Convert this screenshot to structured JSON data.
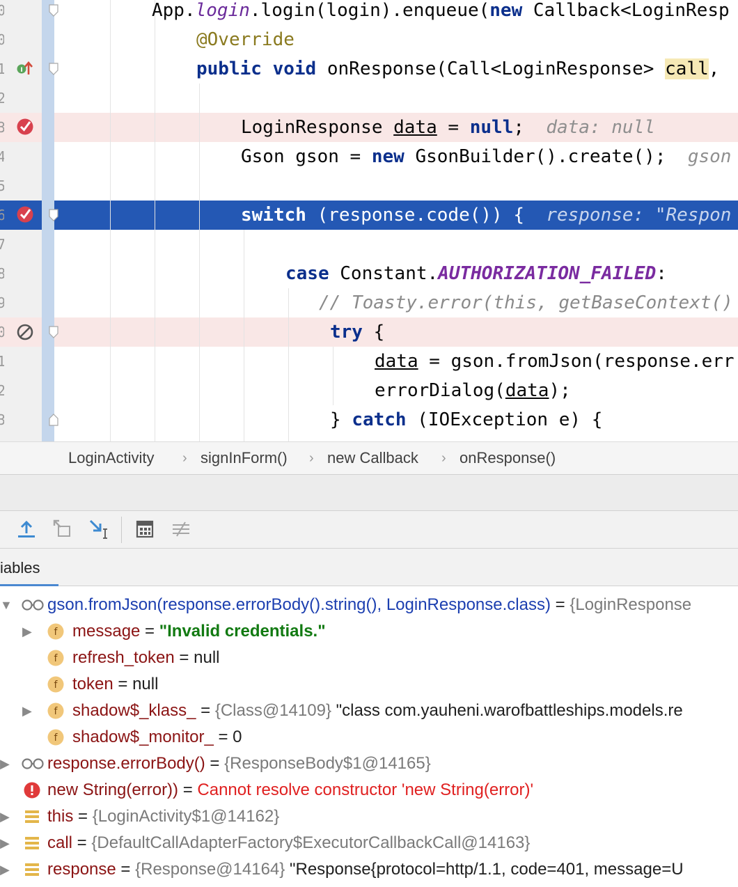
{
  "editor": {
    "lines": {
      "l1": {
        "a": "App.",
        "b": "login",
        "c": ".login(login).enqueue(",
        "d": "new",
        "e": " Callback<LoginResp"
      },
      "l2": {
        "a": "@Override"
      },
      "l3": {
        "a": "public",
        "b": " ",
        "c": "void",
        "d": " onResponse(Call<LoginResponse> ",
        "e": "call",
        ",f": ","
      },
      "l5": {
        "a": "LoginResponse ",
        "b": "data",
        "c": " = ",
        "d": "null",
        "e": ";",
        "hint": "data: null"
      },
      "l6": {
        "a": "Gson gson = ",
        "b": "new",
        "c": " GsonBuilder().create();",
        "hint": "gson"
      },
      "l8": {
        "a": "switch",
        "b": " (response.code()) {",
        "hint": "response: \"Respon"
      },
      "l10": {
        "a": "case",
        "b": " Constant.",
        "c": "AUTHORIZATION_FAILED",
        "d": ":"
      },
      "l11": {
        "a": "// Toasty.error(this, getBaseContext()"
      },
      "l12": {
        "a": "try",
        "b": " {"
      },
      "l13": {
        "a": "data",
        "b": " = gson.fromJson(response.err"
      },
      "l14": {
        "a": "errorDialog(",
        "b": "data",
        "c": ");"
      },
      "l15": {
        "a": "} ",
        "b": "catch",
        "c": " (IOException e) {"
      }
    }
  },
  "breadcrumb": [
    "LoginActivity",
    "signInForm()",
    "new Callback",
    "onResponse()"
  ],
  "breadcrumb_sep": "›",
  "variables_tab": "iables",
  "variables": [
    {
      "arrow": "▼",
      "name": "gson.fromJson(response.errorBody().string(), LoginResponse.class)",
      "eq": " = ",
      "ref": "{LoginResponse"
    },
    {
      "arrow": "▶",
      "name": "message",
      "eq": " = ",
      "str": "\"Invalid credentials.\""
    },
    {
      "name": "refresh_token",
      "eq": " = ",
      "val": "null"
    },
    {
      "name": "token",
      "eq": " = ",
      "val": "null"
    },
    {
      "arrow": "▶",
      "name": "shadow$_klass_",
      "eq": " = ",
      "ref": "{Class@14109}",
      "val": " \"class com.yauheni.warofbattleships.models.re"
    },
    {
      "name": "shadow$_monitor_",
      "eq": " = ",
      "val": "0"
    },
    {
      "arrow": "▶",
      "name": "response.errorBody()",
      "eq": " = ",
      "ref": "{ResponseBody$1@14165}"
    },
    {
      "name": "new String(error))",
      "eq": " = ",
      "err": "Cannot resolve constructor 'new String(error)'"
    },
    {
      "arrow": "▶",
      "name": "this",
      "eq": " = ",
      "ref": "{LoginActivity$1@14162}"
    },
    {
      "arrow": "▶",
      "name": "call",
      "eq": " = ",
      "ref": "{DefaultCallAdapterFactory$ExecutorCallbackCall@14163}"
    },
    {
      "arrow": "▶",
      "name": "response",
      "eq": " = ",
      "ref": "{Response@14164}",
      "val": " \"Response{protocol=http/1.1, code=401, message=U"
    }
  ],
  "icon_names": {
    "field": "field-icon",
    "watch": "watch-glasses-icon",
    "error": "error-icon",
    "local": "local-variable-icon",
    "breakpoint": "breakpoint-check-icon",
    "disabled": "disabled-breakpoint-icon",
    "override": "override-implements-icon",
    "step_out": "step-out-icon",
    "drop_frame": "drop-frame-icon",
    "run_to_cursor": "run-to-cursor-icon",
    "evaluate": "evaluate-expression-icon",
    "trace": "trace-icon"
  }
}
